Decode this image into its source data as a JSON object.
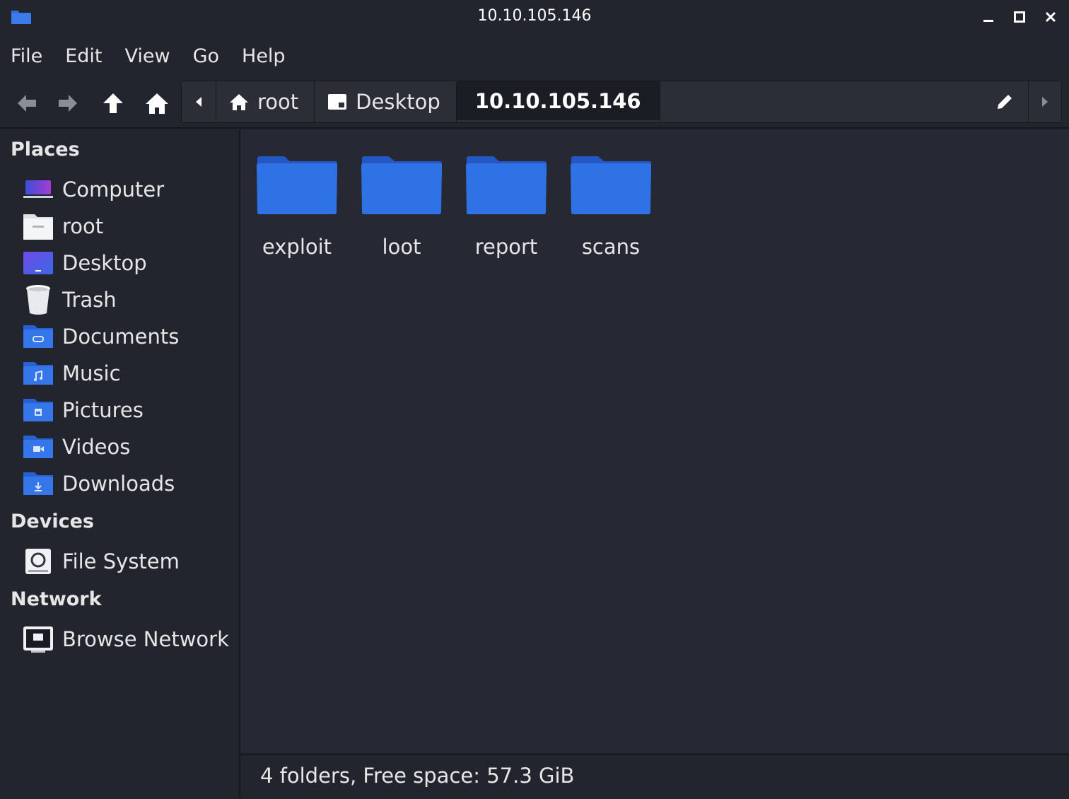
{
  "window": {
    "title": "10.10.105.146"
  },
  "menu": [
    "File",
    "Edit",
    "View",
    "Go",
    "Help"
  ],
  "toolbar": {
    "back_icon": "arrow-left-icon",
    "forward_icon": "arrow-right-icon",
    "up_icon": "arrow-up-icon",
    "home_icon": "home-icon"
  },
  "pathbar": {
    "crumbs": [
      {
        "label": "root",
        "icon": "home-icon"
      },
      {
        "label": "Desktop",
        "icon": "desktop-icon"
      },
      {
        "label": "10.10.105.146",
        "active": true
      }
    ]
  },
  "sidebar": {
    "places_heading": "Places",
    "places": [
      {
        "label": "Computer",
        "icon": "computer-icon"
      },
      {
        "label": "root",
        "icon": "home-folder-icon"
      },
      {
        "label": "Desktop",
        "icon": "desktop-icon"
      },
      {
        "label": "Trash",
        "icon": "trash-icon"
      },
      {
        "label": "Documents",
        "icon": "documents-folder-icon"
      },
      {
        "label": "Music",
        "icon": "music-folder-icon"
      },
      {
        "label": "Pictures",
        "icon": "pictures-folder-icon"
      },
      {
        "label": "Videos",
        "icon": "videos-folder-icon"
      },
      {
        "label": "Downloads",
        "icon": "downloads-folder-icon"
      }
    ],
    "devices_heading": "Devices",
    "devices": [
      {
        "label": "File System",
        "icon": "drive-icon"
      }
    ],
    "network_heading": "Network",
    "network": [
      {
        "label": "Browse Network",
        "icon": "network-icon"
      }
    ]
  },
  "main": {
    "folders": [
      "exploit",
      "loot",
      "report",
      "scans"
    ]
  },
  "status": {
    "text": "4 folders, Free space: 57.3 GiB"
  },
  "colors": {
    "background": "#23252e",
    "content_background": "#262833",
    "folder_blue": "#2f6fe4",
    "text": "#e6e6e6"
  }
}
